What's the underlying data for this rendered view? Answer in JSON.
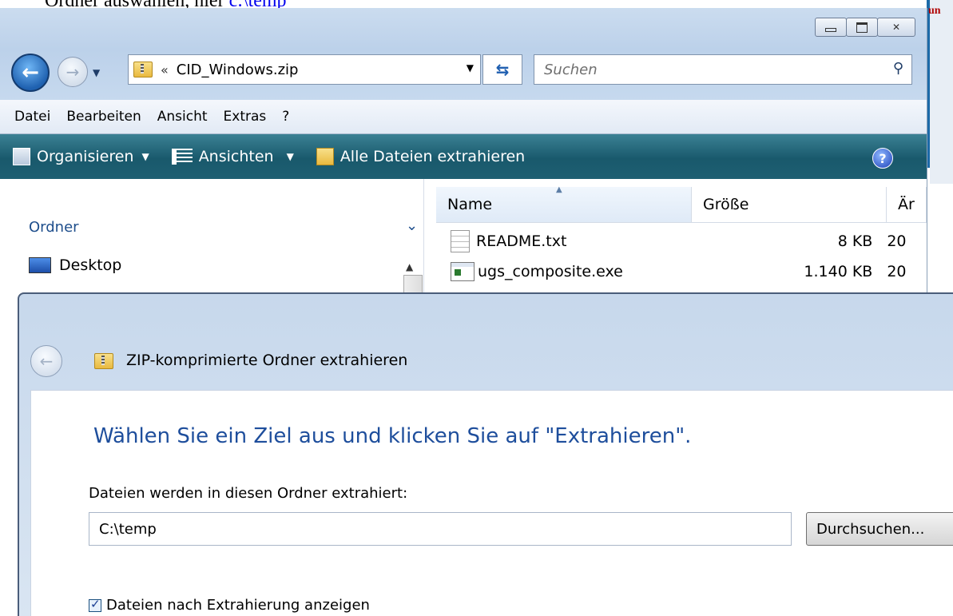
{
  "document": {
    "text": "Ordner auswählen, hier ",
    "link": "c:\\temp"
  },
  "explorer": {
    "address": {
      "chevron": "«",
      "path": "CID_Windows.zip"
    },
    "search_placeholder": "Suchen",
    "menu": [
      "Datei",
      "Bearbeiten",
      "Ansicht",
      "Extras",
      "?"
    ],
    "commands": {
      "organize": "Organisieren",
      "views": "Ansichten",
      "extract_all": "Alle Dateien extrahieren"
    },
    "nav_pane": {
      "header": "Ordner",
      "items": [
        "Desktop"
      ]
    },
    "columns": {
      "name": "Name",
      "size": "Größe",
      "date": "Är"
    },
    "files": [
      {
        "name": "README.txt",
        "size": "8 KB",
        "date": "20"
      },
      {
        "name": "ugs_composite.exe",
        "size": "1.140 KB",
        "date": "20"
      }
    ]
  },
  "dialog": {
    "title": "ZIP-komprimierte Ordner extrahieren",
    "heading": "Wählen Sie ein Ziel aus und klicken Sie auf \"Extrahieren\".",
    "dest_label": "Dateien werden in diesen Ordner extrahiert:",
    "dest_value": "C:\\temp",
    "browse_label": "Durchsuchen...",
    "show_files_label": "Dateien nach Extrahierung anzeigen",
    "show_files_checked": true
  },
  "right_fragment": "un"
}
